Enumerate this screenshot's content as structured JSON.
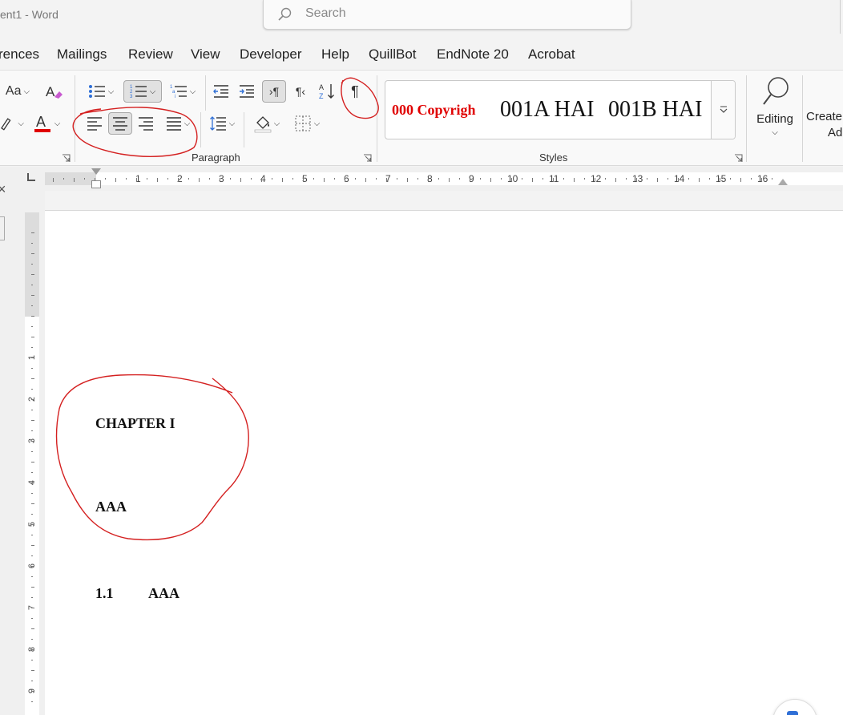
{
  "window": {
    "title": "ent1  -  Word"
  },
  "search": {
    "placeholder": "Search"
  },
  "tabs": [
    "rences",
    "Mailings",
    "Review",
    "View",
    "Developer",
    "Help",
    "QuillBot",
    "EndNote 20",
    "Acrobat"
  ],
  "ribbon": {
    "font": {
      "change_case_label": "Aa"
    },
    "paragraph": {
      "label": "Paragraph",
      "show_marks_glyph": "¶",
      "ltr_glyph": "¶",
      "rtl_glyph": "¶"
    },
    "styles": {
      "label": "Styles",
      "items": [
        "000 Copyrigh",
        "001A HAI",
        "001B HAI"
      ]
    },
    "editing": {
      "label": "Editing"
    },
    "create": {
      "line1": "Create",
      "line2": "Ad"
    }
  },
  "ruler": {
    "horizontal_numbers": [
      "1",
      "2",
      "3",
      "4",
      "5",
      "6",
      "7",
      "8",
      "9",
      "10",
      "11",
      "12",
      "13",
      "14",
      "15",
      "16"
    ],
    "vertical_numbers": [
      "1",
      "2",
      "3",
      "4",
      "5",
      "6",
      "7",
      "8",
      "9"
    ]
  },
  "document": {
    "heading": "CHAPTER I",
    "subheading": "AAA",
    "section_number": "1.1",
    "section_title": "AAA"
  },
  "colors": {
    "annotation_red": "#d42020",
    "font_color_bar": "#e00000",
    "style_red": "#e00000",
    "accent": "#2f6fd6"
  }
}
